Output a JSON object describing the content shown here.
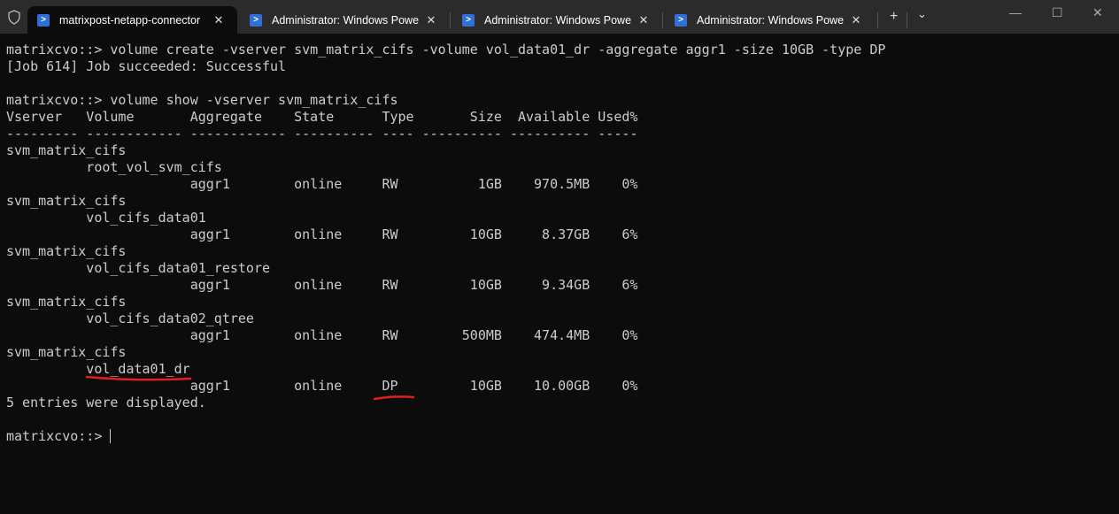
{
  "tabs": [
    {
      "label": "matrixpost-netapp-connector",
      "active": true,
      "icon": "powershell-icon"
    },
    {
      "label": "Administrator: Windows PowerShell",
      "icon": "powershell-icon"
    },
    {
      "label": "Administrator: Windows PowerShell",
      "icon": "powershell-icon"
    },
    {
      "label": "Administrator: Windows PowerShell",
      "icon": "powershell-icon"
    }
  ],
  "new_tab": "+",
  "dropdown": "⌄",
  "window": {
    "minimize": "—",
    "maximize": "☐",
    "close": "✕"
  },
  "terminal": {
    "lines": [
      "matrixcvo::> volume create -vserver svm_matrix_cifs -volume vol_data01_dr -aggregate aggr1 -size 10GB -type DP",
      "[Job 614] Job succeeded: Successful",
      "",
      "matrixcvo::> volume show -vserver svm_matrix_cifs",
      "Vserver   Volume       Aggregate    State      Type       Size  Available Used%",
      "--------- ------------ ------------ ---------- ---- ---------- ---------- -----",
      "svm_matrix_cifs",
      "          root_vol_svm_cifs",
      "                       aggr1        online     RW          1GB    970.5MB    0%",
      "svm_matrix_cifs",
      "          vol_cifs_data01",
      "                       aggr1        online     RW         10GB     8.37GB    6%",
      "svm_matrix_cifs",
      "          vol_cifs_data01_restore",
      "                       aggr1        online     RW         10GB     9.34GB    6%",
      "svm_matrix_cifs",
      "          vol_cifs_data02_qtree",
      "                       aggr1        online     RW        500MB    474.4MB    0%",
      "svm_matrix_cifs",
      "          vol_data01_dr",
      "                       aggr1        online     DP         10GB    10.00GB    0%",
      "5 entries were displayed.",
      "",
      "matrixcvo::> "
    ]
  },
  "annotation_color": "#e0201b"
}
